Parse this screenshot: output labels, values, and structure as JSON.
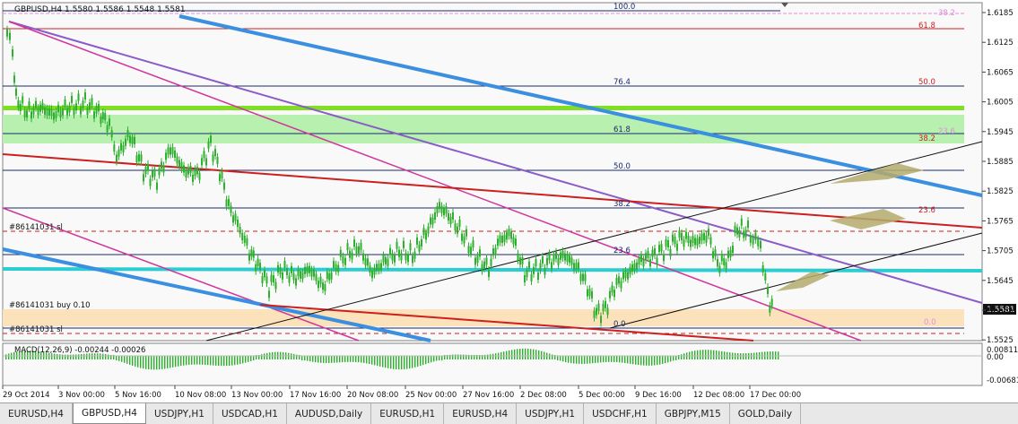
{
  "chart": {
    "header": "GBPUSD,H4  1.5580 1.5586 1.5548 1.5581",
    "current_price": "1.5581",
    "price_axis_labels": [
      "1.6185",
      "1.6125",
      "1.6065",
      "1.6005",
      "1.5945",
      "1.5885",
      "1.5825",
      "1.5765",
      "1.5705",
      "1.5645",
      "1.5585",
      "1.5525"
    ],
    "date_axis_labels": [
      "29 Oct 2014",
      "3 Nov 00:00",
      "5 Nov 16:00",
      "10 Nov 08:00",
      "13 Nov 00:00",
      "17 Nov 16:00",
      "20 Nov 08:00",
      "25 Nov 00:00",
      "27 Nov 16:00",
      "2 Dec 08:00",
      "5 Dec 00:00",
      "9 Dec 16:00",
      "12 Dec 08:00",
      "17 Dec 00:00"
    ],
    "fib_left": [
      "100.0",
      "76.4",
      "61.8",
      "50.0",
      "38.2",
      "23.6",
      "0.0"
    ],
    "fib_right": [
      "38.2",
      "61.8",
      "50.0",
      "23.6",
      "38.2",
      "23.6",
      "0.0"
    ],
    "object_labels": [
      "#86141031 sl",
      "#86141031 buy 0.10",
      "#86141031 sl"
    ],
    "macd_label": "MACD(12,26,9) -0.00244 -0.00026",
    "macd_axis_labels": [
      "0.00811",
      "0.00",
      "-0.00681"
    ]
  },
  "colors": {
    "blue_channel": "#3a8fe0",
    "purple_line": "#8a5cc8",
    "magenta_line": "#d0359c",
    "red_line": "#cc1f1f",
    "cyan_line": "#2ccdd0",
    "lime_band": "#7ee020",
    "green_zone": "#b8f0b0",
    "peach_zone": "#fbe2bb",
    "candle": "#2db02d"
  },
  "tabs": [
    {
      "label": "EURUSD,H4",
      "active": false
    },
    {
      "label": "GBPUSD,H4",
      "active": true
    },
    {
      "label": "USDJPY,H1",
      "active": false
    },
    {
      "label": "USDCAD,H1",
      "active": false
    },
    {
      "label": "AUDUSD,Daily",
      "active": false
    },
    {
      "label": "EURUSD,H1",
      "active": false
    },
    {
      "label": "EURUSD,H4",
      "active": false
    },
    {
      "label": "USDJPY,H1",
      "active": false
    },
    {
      "label": "USDCHF,H1",
      "active": false
    },
    {
      "label": "GBPJPY,M15",
      "active": false
    },
    {
      "label": "GOLD,Daily",
      "active": false
    }
  ]
}
